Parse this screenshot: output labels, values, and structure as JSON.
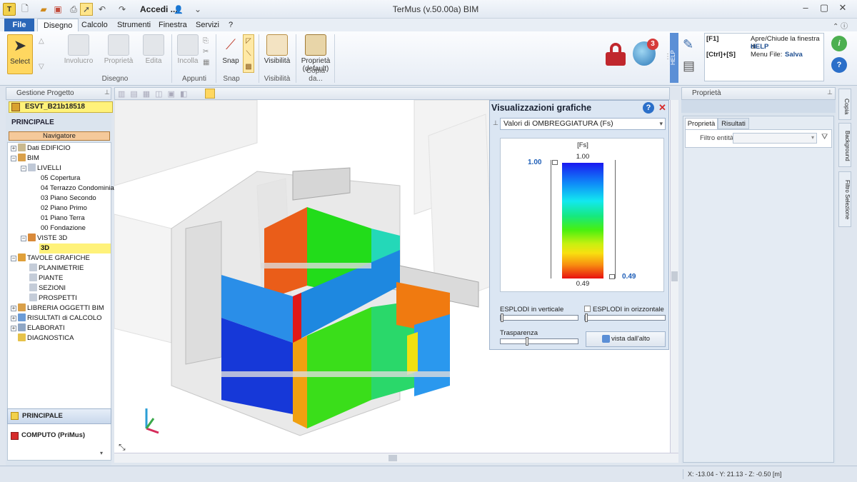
{
  "app": {
    "title": "TerMus (v.50.00a) BIM",
    "login_label": "Accedi ...",
    "window_buttons": [
      "‒",
      "▢",
      "✕"
    ]
  },
  "tabs": [
    {
      "label": "File"
    },
    {
      "label": "Disegno"
    },
    {
      "label": "Calcolo"
    },
    {
      "label": "Strumenti"
    },
    {
      "label": "Finestra"
    },
    {
      "label": "Servizi"
    },
    {
      "label": "?"
    }
  ],
  "ribbon": {
    "groups": {
      "disegno": "Disegno",
      "appunti": "Appunti",
      "snap": "Snap",
      "visibilita": "Visibilità",
      "copia": "Copia da..."
    },
    "buttons": {
      "select": "Select",
      "involucro": "Involucro",
      "proprieta": "Proprietà",
      "edita": "Edita",
      "incolla": "Incolla",
      "snap": "Snap",
      "visibilita": "Visibilità",
      "proprieta_default": "Proprietà (default)"
    },
    "badge_count": "3",
    "help_tab": "HELP",
    "shortcuts": [
      {
        "key": "[F1]",
        "desc": "Apre/Chiude la finestra di",
        "bold": "HELP"
      },
      {
        "key": "[Ctrl]+[S]",
        "desc": "Menu File:",
        "bold": "Salva"
      }
    ]
  },
  "left_panel": {
    "header": "Gestione Progetto",
    "project_name": "ESVT_B21b18518",
    "section_title": "PRINCIPALE",
    "navigator": "Navigatore",
    "tree": {
      "dati": "Dati EDIFICIO",
      "bim": "BIM",
      "livelli": "LIVELLI",
      "l05": "05 Copertura",
      "l04": "04 Terrazzo Condominiale",
      "l03": "03 Piano Secondo",
      "l02": "02 Piano Primo",
      "l01": "01 Piano Terra",
      "l00": "00 Fondazione",
      "viste": "VISTE 3D",
      "v3d": "3D",
      "tavole": "TAVOLE GRAFICHE",
      "planimetrie": "PLANIMETRIE",
      "piante": "PIANTE",
      "sezioni": "SEZIONI",
      "prospetti": "PROSPETTI",
      "libreria": "LIBRERIA OGGETTI BIM",
      "risultati": "RISULTATI di CALCOLO",
      "elaborati": "ELABORATI",
      "diagnostica": "DIAGNOSTICA"
    },
    "bottom_nav": {
      "principale": "PRINCIPALE",
      "computo": "COMPUTO (PriMus)"
    }
  },
  "viz_panel": {
    "title": "Visualizzazioni grafiche",
    "dropdown_value": "Valori di OMBREGGIATURA (Fs)",
    "legend_unit": "[Fs]",
    "legend_top": "1.00",
    "legend_bottom": "0.49",
    "slider_max": "1.00",
    "slider_min": "0.49",
    "esplodi_v": "ESPLODI in verticale",
    "esplodi_h": "ESPLODI in orizzontale",
    "trasparenza": "Trasparenza",
    "vista_alto": "vista dall'alto",
    "trasparenza_level": 0.33
  },
  "right_panel": {
    "header": "Proprietà",
    "tabs": [
      "Proprietà",
      "Risultati"
    ],
    "filtro_label": "Filtro entità",
    "side_tabs": [
      "Copia",
      "Background",
      "Filtro Selezione"
    ]
  },
  "status": {
    "coords": "X: -13.04 - Y: 21.13 - Z: -0.50 [m]"
  },
  "colors": {
    "accent": "#2b67b8",
    "highlight_yellow": "#fff27a",
    "lock_red": "#c0272d",
    "help_green": "#4caf50",
    "help_blue": "#2b6fc9"
  }
}
